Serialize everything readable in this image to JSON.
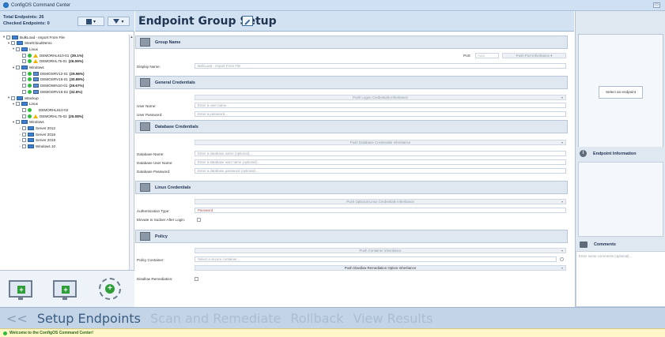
{
  "window": {
    "title": "ConfigOS Command Center",
    "control": "▭"
  },
  "left": {
    "total_endpoints": "Total Endpoints: 26",
    "checked_endpoints": "Checked Endpoints: 0",
    "save_icon": "save-icon",
    "filter_icon": "filter-icon",
    "dropdown_arrow": "▾",
    "tree": [
      {
        "label": "BulkLoad - Import From File",
        "expander": "▾",
        "type": "group"
      },
      {
        "label": "SteelCloudDemo",
        "expander": "▾",
        "type": "group"
      },
      {
        "label": "Linux",
        "expander": "▾",
        "type": "group"
      },
      {
        "label": "DEMORHL610-01",
        "score": "(39.1%)",
        "type": "endpoint-warn"
      },
      {
        "label": "DEMORHL75-01",
        "score": "(26.06%)",
        "type": "endpoint-warn"
      },
      {
        "label": "Windows",
        "expander": "▾",
        "type": "group"
      },
      {
        "label": "DEMOSRV12-01",
        "score": "(29.96%)",
        "type": "endpoint-srv"
      },
      {
        "label": "DEMOSRV16-01",
        "score": "(30.89%)",
        "type": "endpoint-srv"
      },
      {
        "label": "DEMOWIN10-01",
        "score": "(29.67%)",
        "type": "endpoint-srv"
      },
      {
        "label": "DEMOSRV16-02",
        "score": "(32.6%)",
        "type": "endpoint-srv"
      },
      {
        "label": "xBackup",
        "expander": "▾",
        "type": "group"
      },
      {
        "label": "Linux",
        "expander": "▾",
        "type": "group"
      },
      {
        "label": "DEMORHL610-02",
        "score": "",
        "type": "endpoint-ok"
      },
      {
        "label": "DEMORHL75-02",
        "score": "(25.08%)",
        "type": "endpoint-warn"
      },
      {
        "label": "Windows",
        "expander": "▾",
        "type": "group"
      },
      {
        "label": "Server 2012",
        "expander": "›",
        "type": "group"
      },
      {
        "label": "Server 2016",
        "expander": "›",
        "type": "group"
      },
      {
        "label": "Server 2019",
        "expander": "›",
        "type": "group"
      },
      {
        "label": "Windows 10",
        "expander": "›",
        "type": "group"
      }
    ],
    "scroll_up": "▲",
    "scroll_down": "▼",
    "actions": [
      "add-endpoint-button",
      "add-group-button",
      "discover-network-button"
    ],
    "plus": "+"
  },
  "main": {
    "title": "Endpoint Group Setup",
    "group_name": {
      "title": "Group Name",
      "port_label": "Port:",
      "port_placeholder": "Auto",
      "port_inherit": "Push Port Inheritance",
      "display_name_label": "Display Name:",
      "display_name_value": "BulkLoad - Import From File"
    },
    "general_credentials": {
      "title": "General Credentials",
      "inherit": "Push Logon Credentials Inheritance",
      "user_name_label": "User Name:",
      "user_name_placeholder": "Enter a user name...",
      "user_password_label": "User Password:",
      "user_password_placeholder": "Enter a password..."
    },
    "database_credentials": {
      "title": "Database Credentials",
      "inherit": "Push Database Credentials Inheritance",
      "db_name_label": "Database Name:",
      "db_name_placeholder": "Enter a database name (optional)...",
      "db_user_label": "Database User Name:",
      "db_user_placeholder": "Enter a database user name (optional)...",
      "db_password_label": "Database Password:",
      "db_password_placeholder": "Enter a database password (optional)..."
    },
    "linux_credentials": {
      "title": "Linux Credentials",
      "inherit": "Push Optional Linux Credentials Inheritance",
      "auth_type_label": "Authentication Type:",
      "auth_type_value": "Password",
      "elevate_label": "Elevate to Sudoer After Login:"
    },
    "policy": {
      "title": "Policy",
      "inherit": "Push Container Inheritance",
      "container_label": "Policy Container:",
      "container_placeholder": "Select a secure container...",
      "remediation_inherit": "Push Disallow Remediation Option Inheritance",
      "disallow_label": "Disallow Remediation:"
    },
    "dropdown_arrow": "▾"
  },
  "right": {
    "select_endpoint": "Select an endpoint",
    "info_title": "Endpoint Information",
    "comments_title": "Comments",
    "comments_placeholder": "Enter some comments (optional)..."
  },
  "nav": {
    "back": "<<",
    "setup": "Setup Endpoints",
    "scan": "Scan and Remediate",
    "rollback": "Rollback",
    "results": "View Results"
  },
  "status": {
    "message": "Welcome to the ConfigOS Command Center!"
  },
  "colors": {
    "accent": "#3a5c82",
    "ok": "#2ebd3a",
    "warn": "#f0b400",
    "header_bg": "#d3e2f2"
  }
}
